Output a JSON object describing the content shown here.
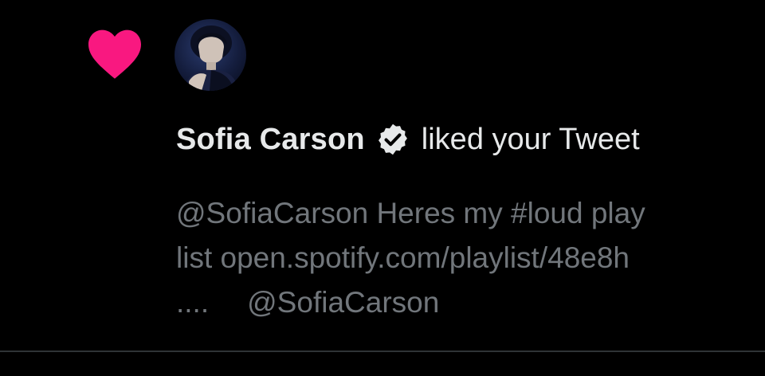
{
  "notification": {
    "user_name": "Sofia Carson",
    "action_text": "liked your Tweet",
    "tweet_lines": [
      "@SofiaCarson Heres my #loud play",
      "list open.spotify.com/playlist/48e8h"
    ],
    "tweet_ellipsis": "....",
    "tweet_mention": "@SofiaCarson",
    "icons": {
      "like": "heart-icon",
      "verified": "verified-badge-icon"
    },
    "colors": {
      "background": "#000000",
      "heart": "#f91880",
      "primary_text": "#e7e9ea",
      "secondary_text": "#71767b",
      "divider": "#2f3336"
    }
  }
}
